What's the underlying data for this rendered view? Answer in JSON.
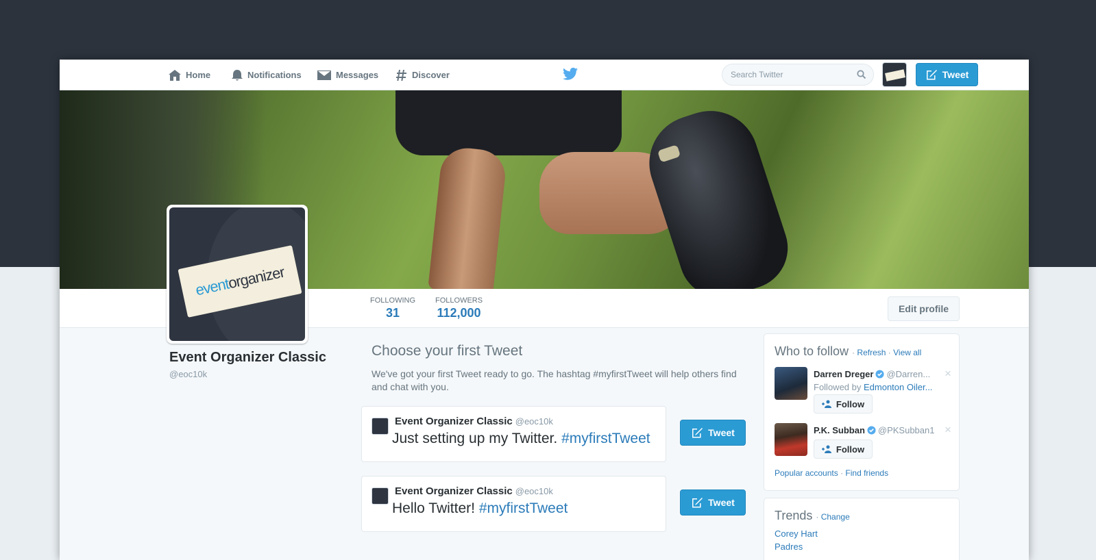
{
  "nav": {
    "home": "Home",
    "notifications": "Notifications",
    "messages": "Messages",
    "discover": "Discover",
    "search_placeholder": "Search Twitter",
    "tweet_label": "Tweet"
  },
  "profile": {
    "name": "Event Organizer Classic",
    "handle": "@eoc10k",
    "avatar_text_1": "event",
    "avatar_text_2": "organizer",
    "stats": {
      "following_label": "FOLLOWING",
      "following_value": "31",
      "followers_label": "FOLLOWERS",
      "followers_value": "112,000"
    },
    "edit_label": "Edit profile"
  },
  "first_tweet": {
    "title": "Choose your first Tweet",
    "description": "We've got your first Tweet ready to go. The hashtag #myfirstTweet will help others find and chat with you.",
    "cards": [
      {
        "author": "Event Organizer Classic",
        "handle": "@eoc10k",
        "text": "Just setting up my Twitter. ",
        "hashtag": "#myfirstTweet",
        "button": "Tweet"
      },
      {
        "author": "Event Organizer Classic",
        "handle": "@eoc10k",
        "text": "Hello Twitter! ",
        "hashtag": "#myfirstTweet",
        "button": "Tweet"
      }
    ]
  },
  "who_to_follow": {
    "title": "Who to follow",
    "refresh": "Refresh",
    "view_all": "View all",
    "suggestions": [
      {
        "name": "Darren Dreger",
        "handle": "@Darren...",
        "followed_by_prefix": "Followed by ",
        "followed_by": "Edmonton Oiler...",
        "follow": "Follow",
        "close": "×"
      },
      {
        "name": "P.K. Subban",
        "handle": "@PKSubban1",
        "follow": "Follow",
        "close": "×"
      }
    ],
    "popular": "Popular accounts",
    "find_friends": "Find friends"
  },
  "trends": {
    "title": "Trends",
    "change": "Change",
    "items": [
      "Corey Hart",
      "Padres"
    ]
  },
  "colors": {
    "accent": "#2b9bd4",
    "link": "#2b7bb9",
    "dark_bg": "#2c333d"
  }
}
